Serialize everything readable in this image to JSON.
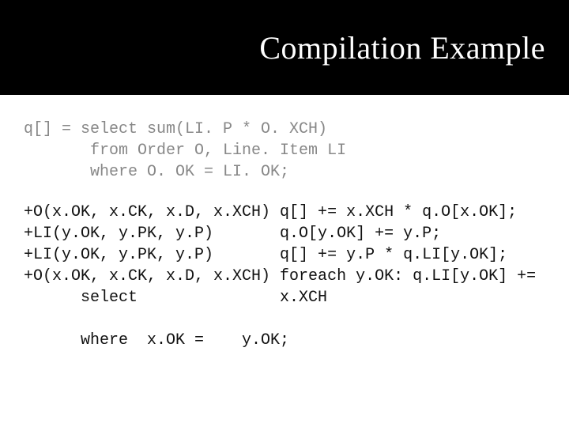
{
  "title": "Compilation Example",
  "query": "q[] = select sum(LI. P * O. XCH)\n       from Order O, Line. Item LI\n       where O. OK = LI. OK;",
  "rules": "+O(x.OK, x.CK, x.D, x.XCH) q[] += x.XCH * q.O[x.OK];\n+LI(y.OK, y.PK, y.P)       q.O[y.OK] += y.P;\n+LI(y.OK, y.PK, y.P)       q[] += y.P * q.LI[y.OK];\n+O(x.OK, x.CK, x.D, x.XCH) foreach y.OK: q.LI[y.OK] +=\n      select               x.XCH\n\n      where  x.OK =    y.OK;"
}
